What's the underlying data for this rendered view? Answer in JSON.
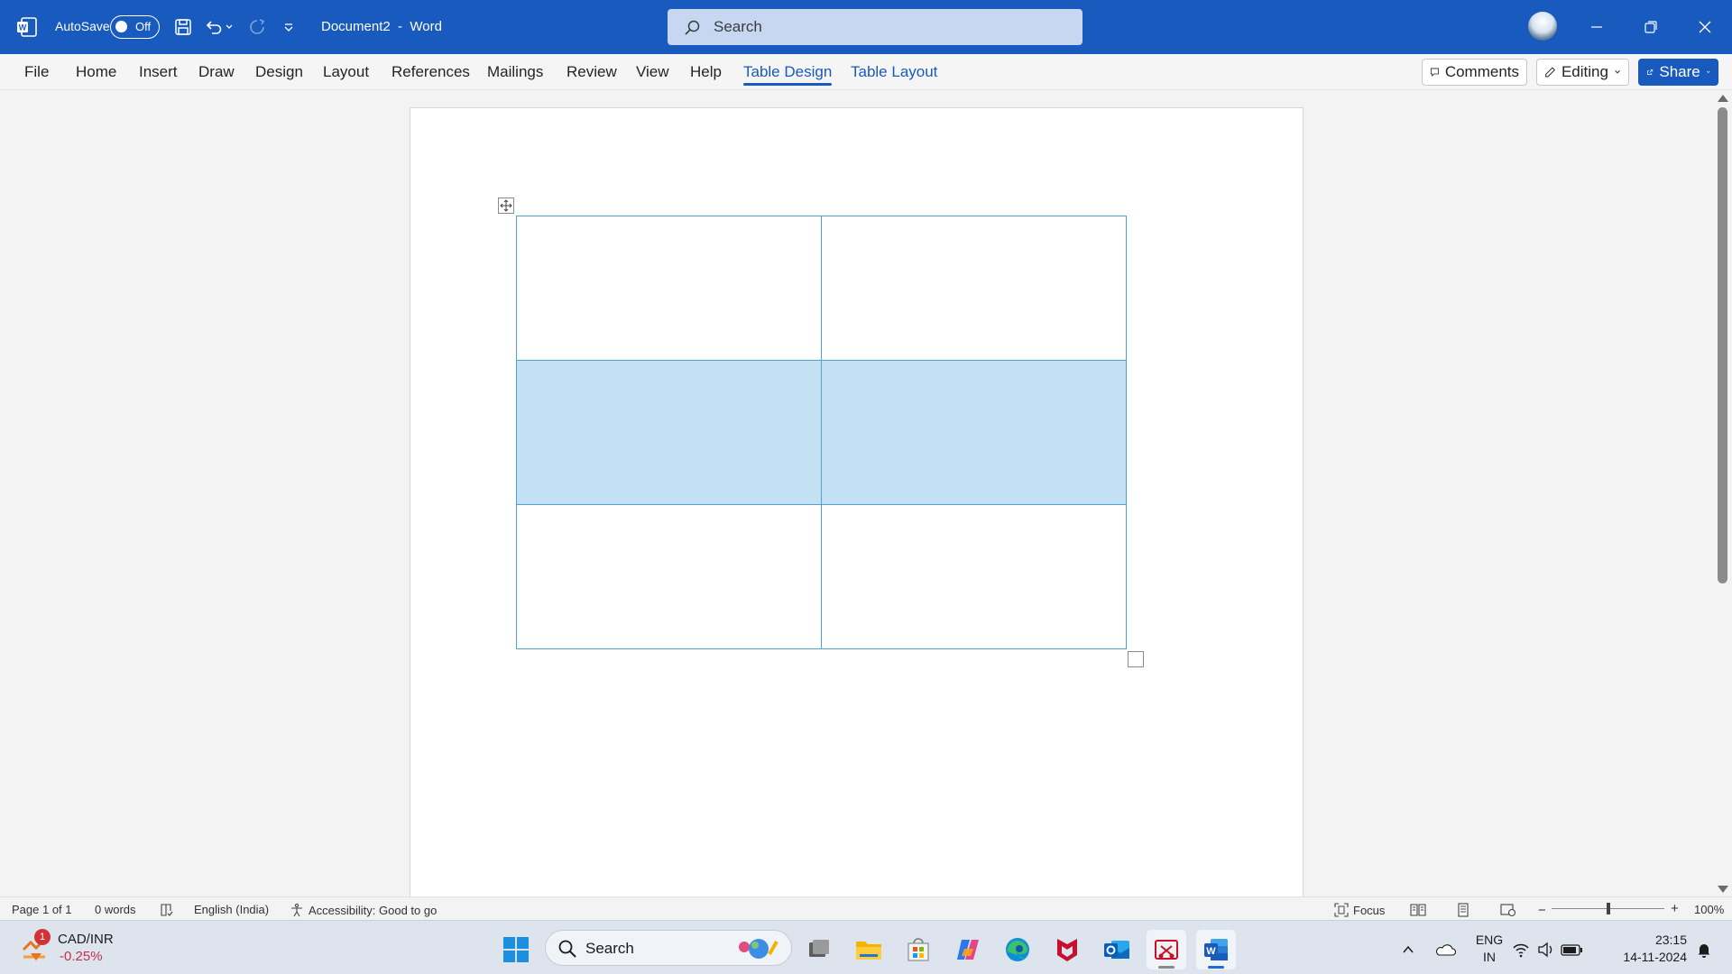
{
  "titlebar": {
    "autosave_label": "AutoSave",
    "autosave_state": "Off",
    "document_title": "Document2  -  Word",
    "search_placeholder": "Search"
  },
  "ribbon": {
    "tabs": [
      "File",
      "Home",
      "Insert",
      "Draw",
      "Design",
      "Layout",
      "References",
      "Mailings",
      "Review",
      "View",
      "Help",
      "Table Design",
      "Table Layout"
    ],
    "active_tab": "Table Design",
    "comments_label": "Comments",
    "editing_label": "Editing",
    "share_label": "Share"
  },
  "document": {
    "table": {
      "rows": 3,
      "cols": 2,
      "selected_row": 2
    }
  },
  "statusbar": {
    "page": "Page 1 of 1",
    "words": "0 words",
    "language": "English (India)",
    "accessibility": "Accessibility: Good to go",
    "focus": "Focus",
    "zoom": "100%"
  },
  "taskbar": {
    "widget_ticker": "CAD/INR",
    "widget_change": "-0.25%",
    "widget_badge": "1",
    "search_label": "Search",
    "lang_line1": "ENG",
    "lang_line2": "IN",
    "time": "23:15",
    "date": "14-11-2024"
  },
  "colors": {
    "word_blue": "#185abd",
    "table_border": "#4fa3d4",
    "selection": "#c3e1f3"
  },
  "icons": [
    "word-logo-icon",
    "save-icon",
    "undo-icon",
    "redo-icon",
    "customize-icon",
    "search-icon",
    "minimize-icon",
    "restore-icon",
    "close-icon",
    "comment-icon",
    "pencil-icon",
    "share-icon",
    "table-move-icon",
    "proofing-icon",
    "accessibility-icon",
    "focus-icon",
    "read-mode-icon",
    "print-layout-icon",
    "web-layout-icon",
    "windows-start-icon",
    "task-view-icon",
    "file-explorer-icon",
    "store-icon",
    "copilot-icon",
    "edge-icon",
    "mcafee-icon",
    "outlook-icon",
    "snipping-tool-icon",
    "word-taskbar-icon",
    "chevron-up-icon",
    "onedrive-icon",
    "wifi-icon",
    "volume-icon",
    "battery-icon",
    "notification-bell-icon"
  ]
}
